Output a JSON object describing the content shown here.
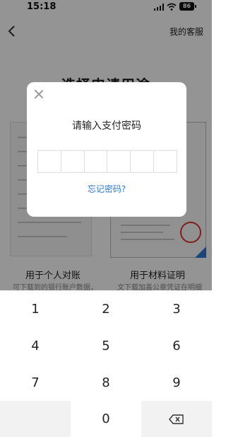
{
  "status_bar": {
    "time": "15:18",
    "battery": "86"
  },
  "nav": {
    "customer_service": "我的客服"
  },
  "page": {
    "title": "选择申请用途"
  },
  "options": [
    {
      "title": "用于个人对账",
      "desc": "可下载到的银行账户数据，将本文件。仅限于个人自检使用"
    },
    {
      "title": "用于材料证明",
      "desc": "文下载加盖公章凭证在明细到证明材料证明，用作出示给第三方，自行加盖"
    }
  ],
  "dialog": {
    "title": "请输入支付密码",
    "forgot_link": "忘记密码?",
    "pin_length": 6
  },
  "keypad": {
    "keys": [
      "1",
      "2",
      "3",
      "4",
      "5",
      "6",
      "7",
      "8",
      "9",
      "",
      "0",
      "delete"
    ]
  },
  "colors": {
    "accent": "#2e77d0",
    "overlay": "rgba(0,0,0,0.42)"
  }
}
